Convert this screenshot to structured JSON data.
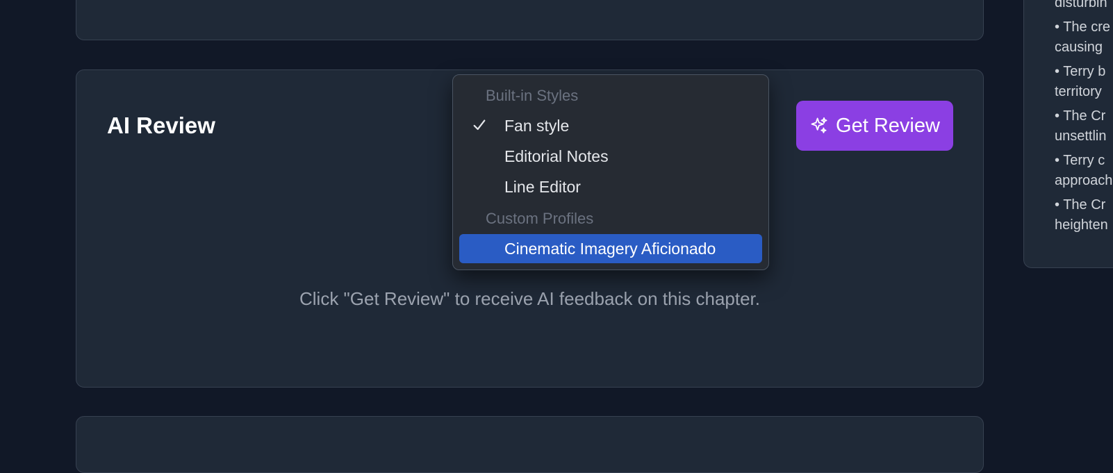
{
  "review": {
    "title": "AI Review",
    "get_review_label": "Get Review",
    "empty_hint": "Click \"Get Review\" to receive AI feedback on this chapter."
  },
  "dropdown": {
    "builtin_label": "Built-in Styles",
    "custom_label": "Custom Profiles",
    "options": [
      {
        "label": "Fan style",
        "checked": true
      },
      {
        "label": "Editorial Notes",
        "checked": false
      },
      {
        "label": "Line Editor",
        "checked": false
      },
      {
        "label": "Cinematic Imagery Aficionado",
        "highlighted": true
      }
    ]
  },
  "side_panel": {
    "first_line": "disturbin",
    "items": [
      {
        "line1": "• The cre",
        "line2": "causing"
      },
      {
        "line1": "• Terry b",
        "line2": "territory"
      },
      {
        "line1": "• The Cr",
        "line2": "unsettlin"
      },
      {
        "line1": "• Terry c",
        "line2": "approach"
      },
      {
        "line1": "• The Cr",
        "line2": "heighten"
      }
    ]
  },
  "colors": {
    "background": "#111827",
    "card": "#1f2937",
    "accent_button": "#8b3fe3",
    "selected_option": "#2a5cc4",
    "focus_border": "#3b82f6"
  },
  "icons": {
    "get_review": "sparkles-icon",
    "selected": "checkmark-icon"
  }
}
